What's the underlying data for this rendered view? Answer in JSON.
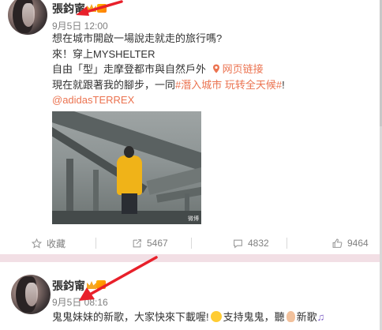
{
  "post1": {
    "username": "張鈞甯",
    "timestamp": "9月5日 12:00",
    "lines": [
      "想在城市開啟一場說走就走的旅行嗎?",
      "來！穿上MYSHELTER",
      "自由「型」走摩登都市與自然戶外"
    ],
    "web_link": "网页链接",
    "line4_prefix": "現在就跟著我的腳步，一同",
    "hashtag": "#潛入城市 玩转全天候#",
    "line4_suffix": "!",
    "mention": "@adidasTERREX",
    "image_watermark": "微博",
    "actions": {
      "favorite": "收藏",
      "share_count": "5467",
      "comment_count": "4832",
      "like_count": "9464"
    }
  },
  "post2": {
    "username": "張鈞甯",
    "timestamp": "9月5日 08:16",
    "text_a": "鬼鬼妹妹的新歌，大家快來下載喔!",
    "text_b": "支持鬼鬼，聽",
    "text_c": "新歌"
  },
  "colors": {
    "link": "#eb7350",
    "arrow": "#e8202a",
    "separator": "#f2dfe5",
    "muted": "#808080"
  },
  "icons": [
    "avatar",
    "vip-badge",
    "crown-badge",
    "link-icon",
    "star-icon",
    "share-icon",
    "comment-icon",
    "thumbs-up-icon",
    "grinning-emoji-icon",
    "ear-emoji-icon",
    "music-note-icon"
  ]
}
